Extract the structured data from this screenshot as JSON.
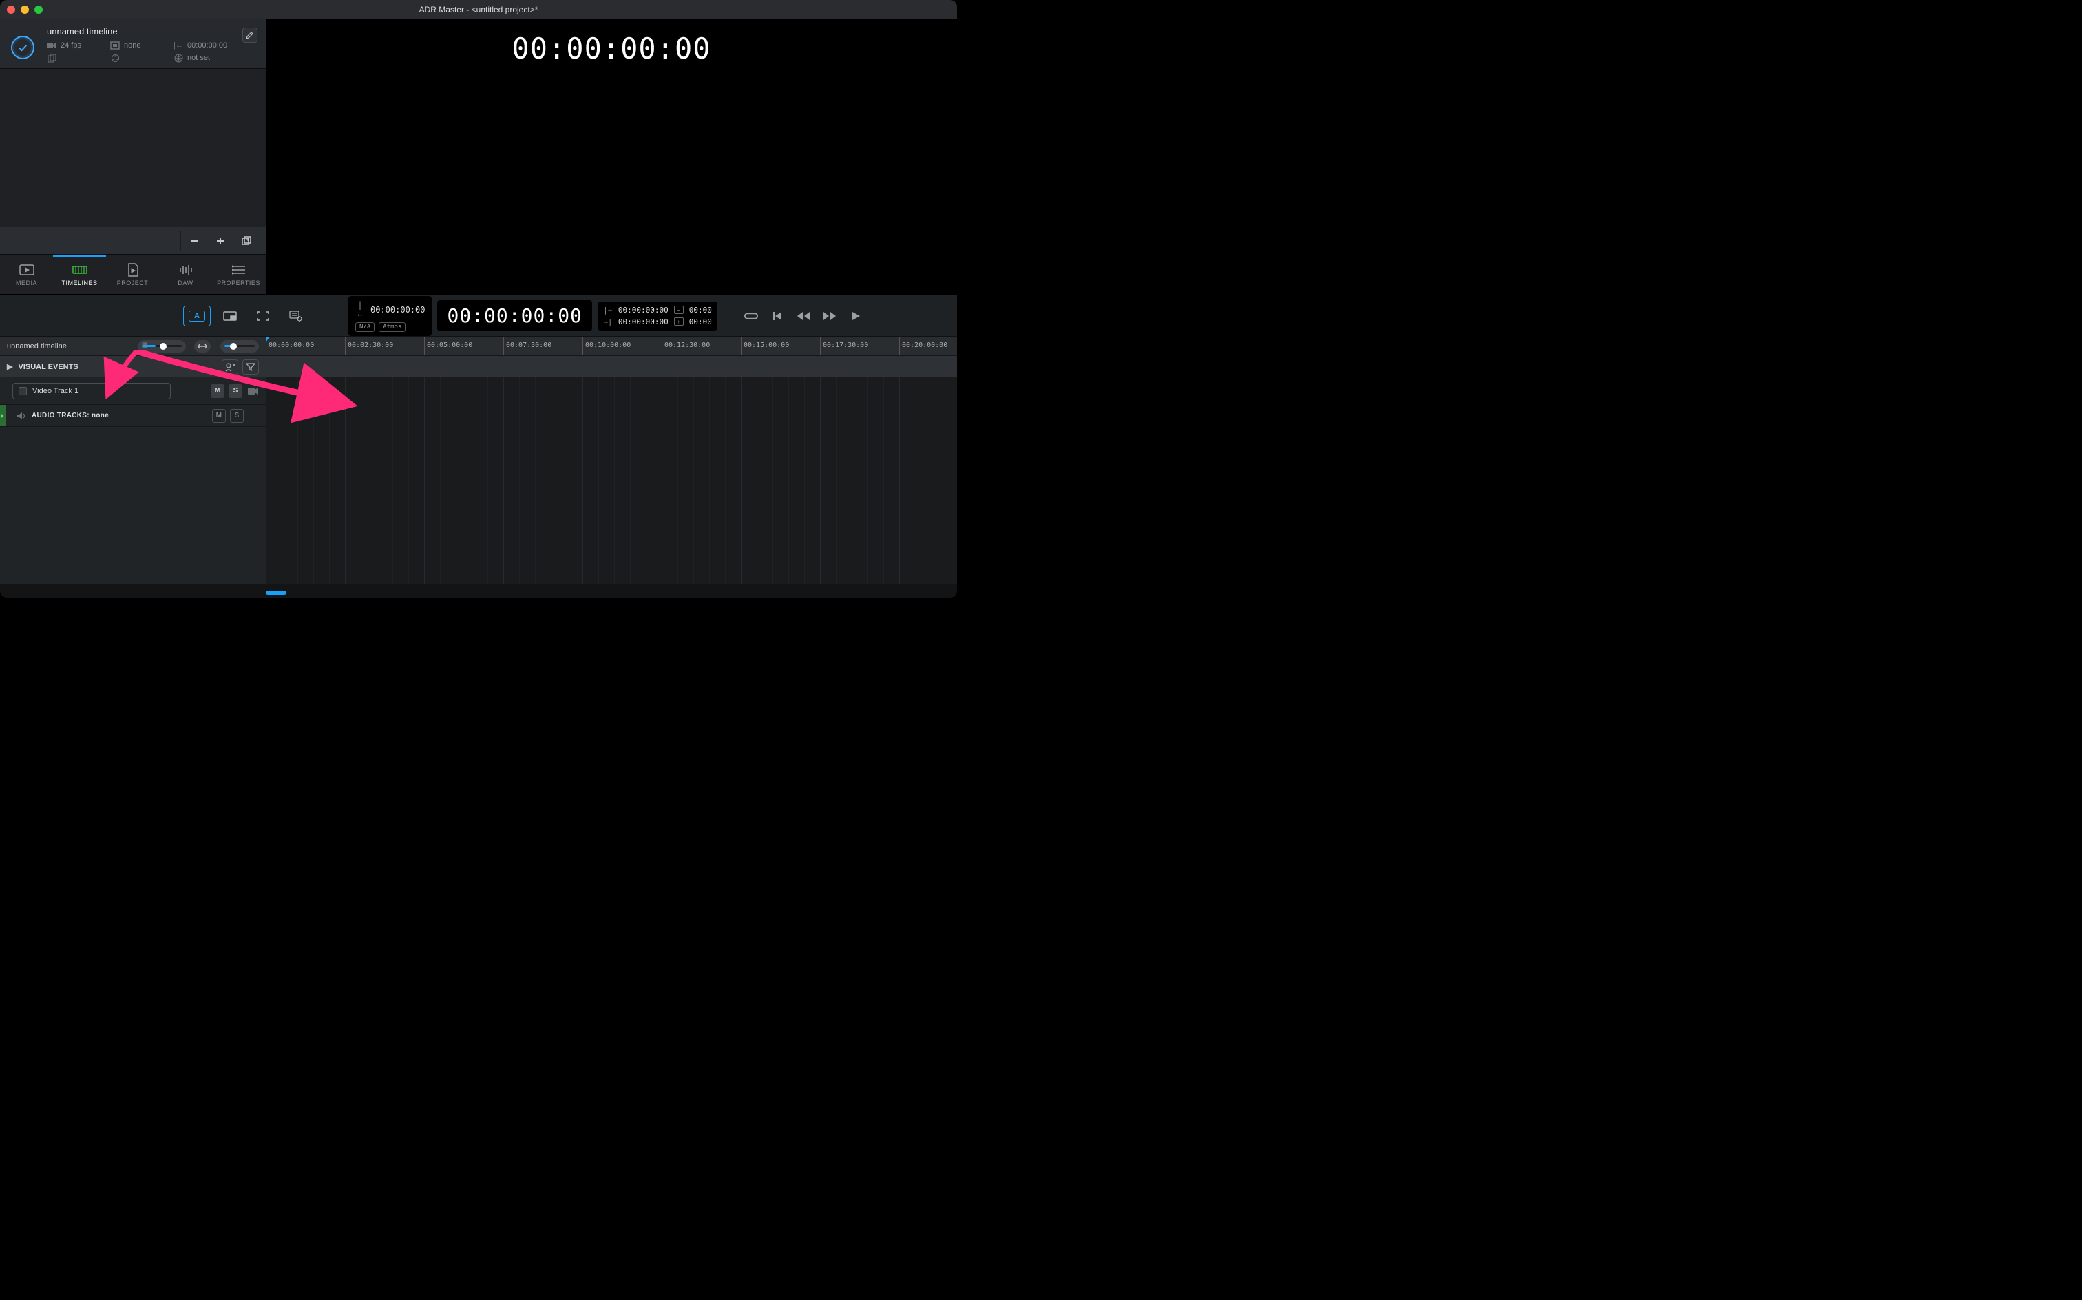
{
  "window": {
    "title": "ADR Master - <untitled project>*"
  },
  "timeline_header": {
    "name": "unnamed timeline",
    "fps": "24 fps",
    "aspect": "none",
    "offset": "00:00:00:00",
    "setting": "not set"
  },
  "tabs": {
    "media": "MEDIA",
    "timelines": "TIMELINES",
    "project": "PROJECT",
    "daw": "DAW",
    "properties": "PROPERTIES"
  },
  "preview": {
    "big_tc": "00:00:00:00"
  },
  "transport": {
    "mode_a_label": "A",
    "in_tc": "00:00:00:00",
    "na": "N/A",
    "atmos": "Atmos",
    "main_tc": "00:00:00:00",
    "mark_in": "00:00:00:00",
    "mark_out": "00:00:00:00",
    "dur1": "00:00",
    "dur2": "00:00"
  },
  "ruler": {
    "left_label": "unnamed timeline",
    "ticks": [
      {
        "pos": 0,
        "label": "00:00:00:00"
      },
      {
        "pos": 115,
        "label": "00:02:30:00"
      },
      {
        "pos": 230,
        "label": "00:05:00:00"
      },
      {
        "pos": 345,
        "label": "00:07:30:00"
      },
      {
        "pos": 460,
        "label": "00:10:00:00"
      },
      {
        "pos": 575,
        "label": "00:12:30:00"
      },
      {
        "pos": 690,
        "label": "00:15:00:00"
      },
      {
        "pos": 805,
        "label": "00:17:30:00"
      },
      {
        "pos": 920,
        "label": "00:20:00:00"
      }
    ]
  },
  "events": {
    "label": "VISUAL EVENTS"
  },
  "tracks": {
    "video_track": "Video Track 1",
    "audio_label": "AUDIO TRACKS: none",
    "m": "M",
    "s": "S"
  }
}
